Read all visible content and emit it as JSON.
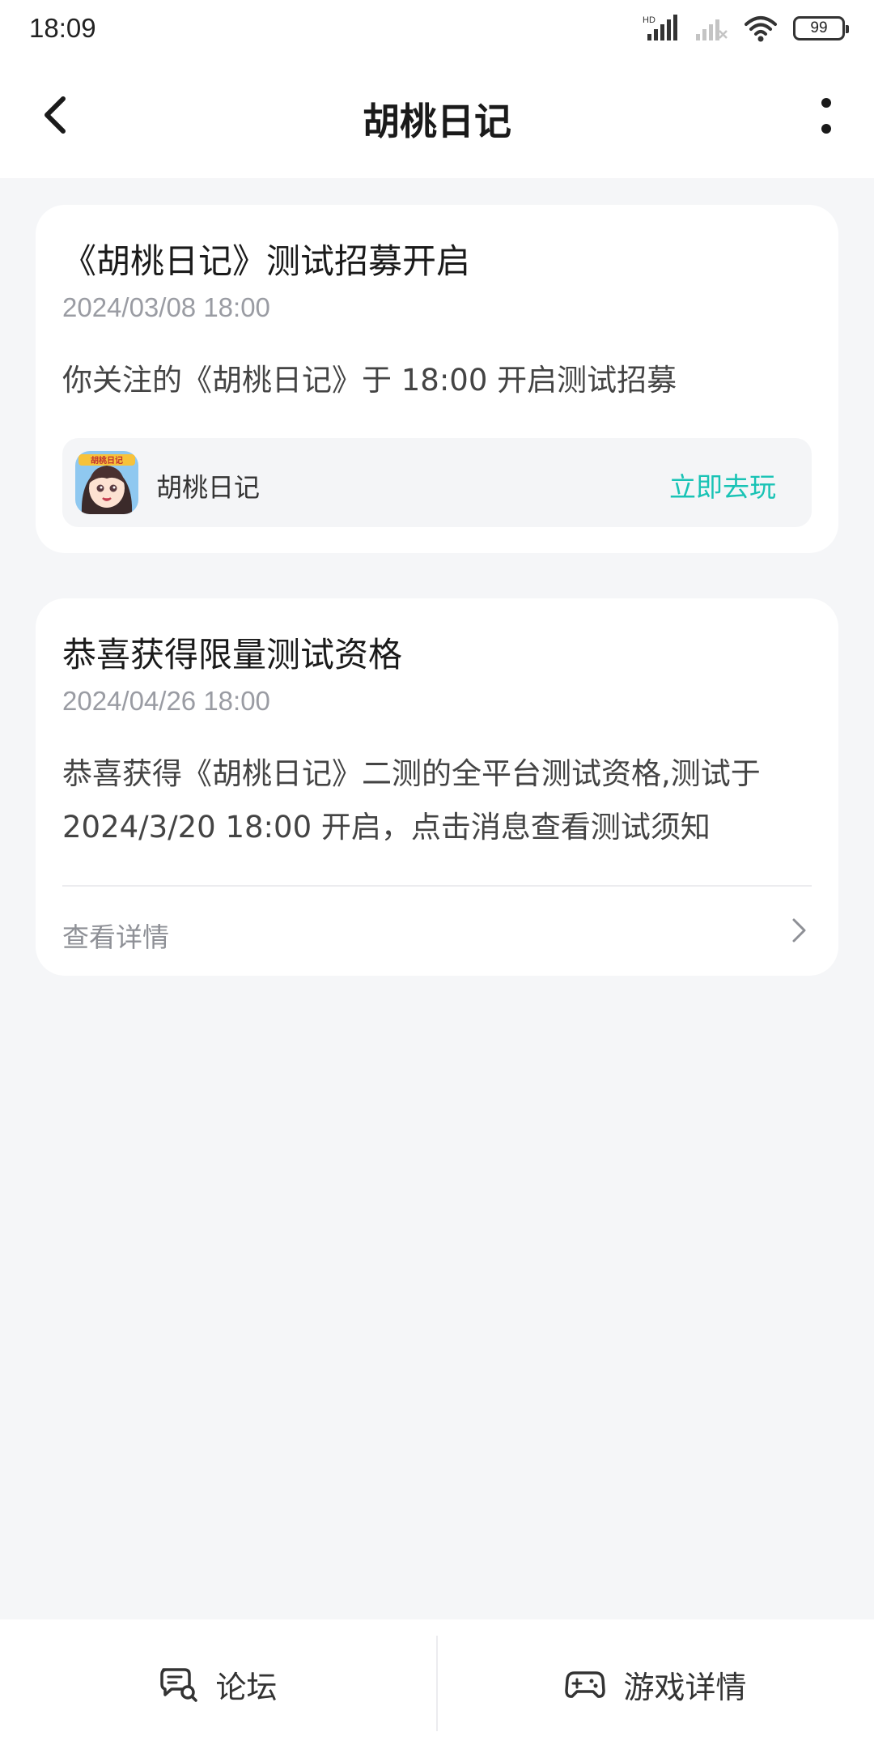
{
  "status": {
    "time": "18:09",
    "battery": "99",
    "hd_label": "HD"
  },
  "header": {
    "title": "胡桃日记"
  },
  "cards": [
    {
      "title": "《胡桃日记》测试招募开启",
      "date": "2024/03/08 18:00",
      "body": "你关注的《胡桃日记》于 18:00 开启测试招募",
      "game": {
        "name": "胡桃日记",
        "action_label": "立即去玩",
        "icon_caption": "胡桃日记"
      }
    },
    {
      "title": "恭喜获得限量测试资格",
      "date": "2024/04/26 18:00",
      "body_line1": "恭喜获得《胡桃日记》二测的全平台测试资格,测试于",
      "body_line2": "2024/3/20 18:00 开启，点击消息查看测试须知",
      "link_label": "查看详情"
    }
  ],
  "bottom_nav": {
    "forum_label": "论坛",
    "game_detail_label": "游戏详情"
  },
  "colors": {
    "accent": "#19c3b5",
    "background": "#f5f6f8"
  }
}
